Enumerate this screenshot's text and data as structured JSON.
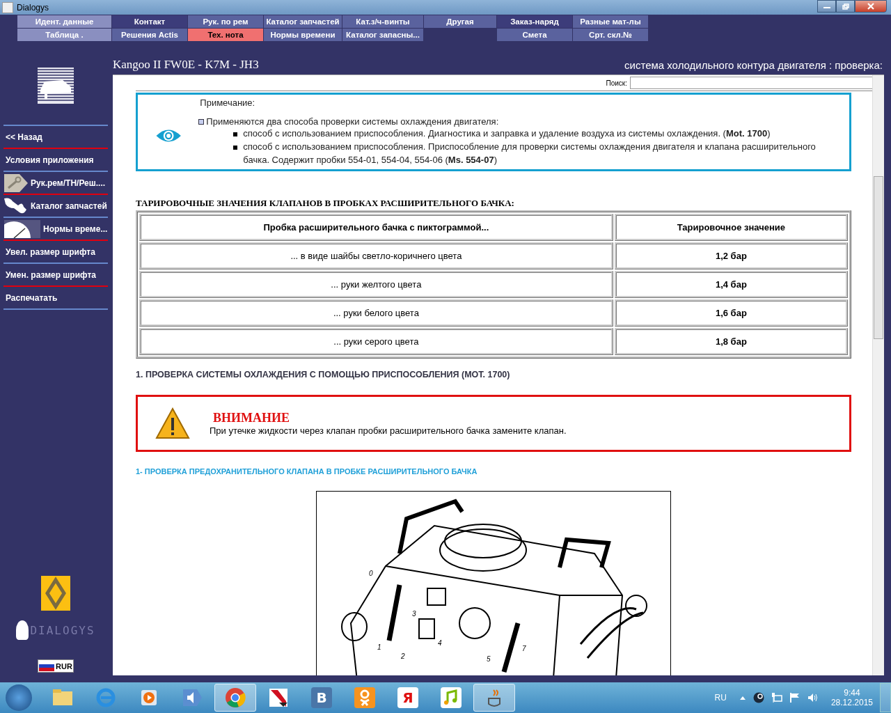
{
  "window": {
    "title": "Dialogys"
  },
  "menu": [
    {
      "top": {
        "label": "Идент. данные",
        "selected": false
      },
      "bottom": {
        "label": "Таблица .",
        "selected": false
      }
    },
    {
      "top": {
        "label": "Контакт",
        "selected": false
      },
      "bottom": {
        "label": "Решения Actis",
        "selected": false
      }
    },
    {
      "top": {
        "label": "Рук. по рем",
        "selected": false
      },
      "bottom": {
        "label": "Тех. нота",
        "selected": true
      }
    },
    {
      "top": {
        "label": "Каталог запчастей",
        "selected": false
      },
      "bottom": {
        "label": "Нормы времени",
        "selected": false
      }
    },
    {
      "top": {
        "label": "Кат.з/ч-винты",
        "selected": false
      },
      "bottom": {
        "label": "Каталог запасны...",
        "selected": false
      }
    },
    {
      "top": {
        "label": "Другая",
        "selected": false
      }
    },
    {
      "top": {
        "label": "Заказ-наряд",
        "selected": false
      },
      "bottom": {
        "label": "Смета",
        "selected": false
      }
    },
    {
      "top": {
        "label": "Разные мат-лы",
        "selected": false
      },
      "bottom": {
        "label": "Срт. скл.№",
        "selected": false
      }
    }
  ],
  "header": {
    "vehicle": "Kangoo II FW0E - K7M - JH3",
    "topic": "система холодильного контура двигателя : проверка:"
  },
  "sidebar": {
    "items": [
      {
        "kind": "text",
        "label": "<< Назад"
      },
      {
        "kind": "text",
        "label": "Условия приложения"
      },
      {
        "kind": "wrench",
        "label": "Рук.рем/ТН/Реш...."
      },
      {
        "kind": "parts",
        "label": "Каталог запчастей"
      },
      {
        "kind": "clock",
        "label": "Нормы време..."
      },
      {
        "kind": "text",
        "label": "Увел. размер шрифта"
      },
      {
        "kind": "text",
        "label": "Умен. размер шрифта"
      },
      {
        "kind": "text",
        "label": "Распечатать"
      }
    ],
    "brand": "DIALOGYS",
    "currency": "RUR"
  },
  "search": {
    "label": "Поиск:"
  },
  "note": {
    "title": "Примечание:",
    "lead": "Применяются два способа проверки системы охлаждения двигателя:",
    "items": [
      "способ с использованием приспособления. Диагностика и заправка и удаление воздуха из системы охлаждения. (**Mot. 1700**)",
      "способ с использованием приспособления. Приспособление для проверки системы охлаждения двигателя и клапана расширительного бачка. Содержит пробки 554-01, 554-04, 554-06 (**Ms. 554-07**)"
    ]
  },
  "table": {
    "title": "ТАРИРОВОЧНЫЕ ЗНАЧЕНИЯ КЛАПАНОВ В ПРОБКАХ РАСШИРИТЕЛЬНОГО БАЧКА:",
    "columns": [
      "Пробка расширительного бачка с пиктограммой...",
      "Тарировочное значение"
    ],
    "rows": [
      [
        "... в виде шайбы светло-коричнего цвета",
        "1,2 бар"
      ],
      [
        "... руки желтого цвета",
        "1,4 бар"
      ],
      [
        "... руки белого цвета",
        "1,6 бар"
      ],
      [
        "... руки серого цвета",
        "1,8 бар"
      ]
    ]
  },
  "section": "1. ПРОВЕРКА СИСТЕМЫ ОХЛАЖДЕНИЯ С ПОМОЩЬЮ ПРИСПОСОБЛЕНИЯ (MOT. 1700)",
  "warning": {
    "title": "ВНИМАНИЕ",
    "text": "При утечке жидкости через клапан пробки расширительного бачка замените клапан."
  },
  "subsection": "1- ПРОВЕРКА ПРЕДОХРАНИТЕЛЬНОГО КЛАПАНА В ПРОБКЕ РАСШИРИТЕЛЬНОГО БАЧКА",
  "figure": {
    "callouts": [
      "0",
      "1",
      "2",
      "3",
      "4",
      "5",
      "7"
    ]
  },
  "taskbar": {
    "apps": [
      {
        "kind": "folder",
        "active": false
      },
      {
        "kind": "browser-e",
        "active": false
      },
      {
        "kind": "player",
        "active": false
      },
      {
        "kind": "speaker",
        "active": false
      },
      {
        "kind": "chrome",
        "active": true
      },
      {
        "kind": "shield",
        "active": false
      },
      {
        "kind": "letter",
        "glyph": "В",
        "active": false
      },
      {
        "kind": "ok",
        "active": false
      },
      {
        "kind": "letter-tag",
        "glyph": "Я",
        "active": false
      },
      {
        "kind": "music",
        "active": false
      },
      {
        "kind": "java",
        "active": true
      }
    ],
    "language": "RU",
    "time": "9:44",
    "date": "28.12.2015"
  }
}
